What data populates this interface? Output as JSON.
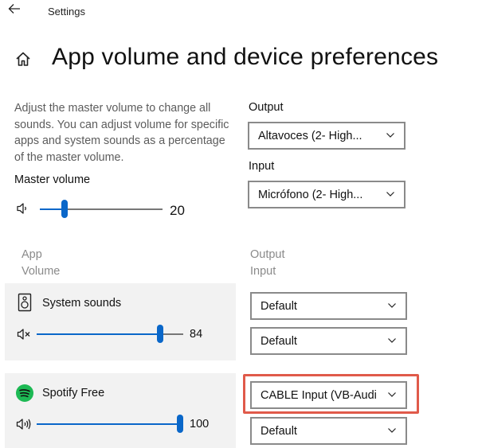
{
  "window": {
    "title": "Settings"
  },
  "page": {
    "title": "App volume and device preferences"
  },
  "master": {
    "description": "Adjust the master volume to change all sounds. You can adjust volume for specific apps and system sounds as a percentage of the master volume.",
    "label": "Master volume",
    "value": "20",
    "level": 0.2
  },
  "output": {
    "label": "Output",
    "selected": "Altavoces (2- High..."
  },
  "input": {
    "label": "Input",
    "selected": "Micrófono (2- High..."
  },
  "columns": {
    "app": "App",
    "volume": "Volume",
    "output": "Output",
    "input": "Input"
  },
  "apps": [
    {
      "name": "System sounds",
      "volume": "84",
      "level": 0.84,
      "output": "Default",
      "input": "Default"
    },
    {
      "name": "Spotify Free",
      "volume": "100",
      "level": 1.0,
      "output": "CABLE Input (VB-Audi",
      "input": "Default"
    }
  ],
  "colors": {
    "accent": "#0a67c9",
    "highlight": "#e05a4a",
    "spotify": "#1db954"
  }
}
